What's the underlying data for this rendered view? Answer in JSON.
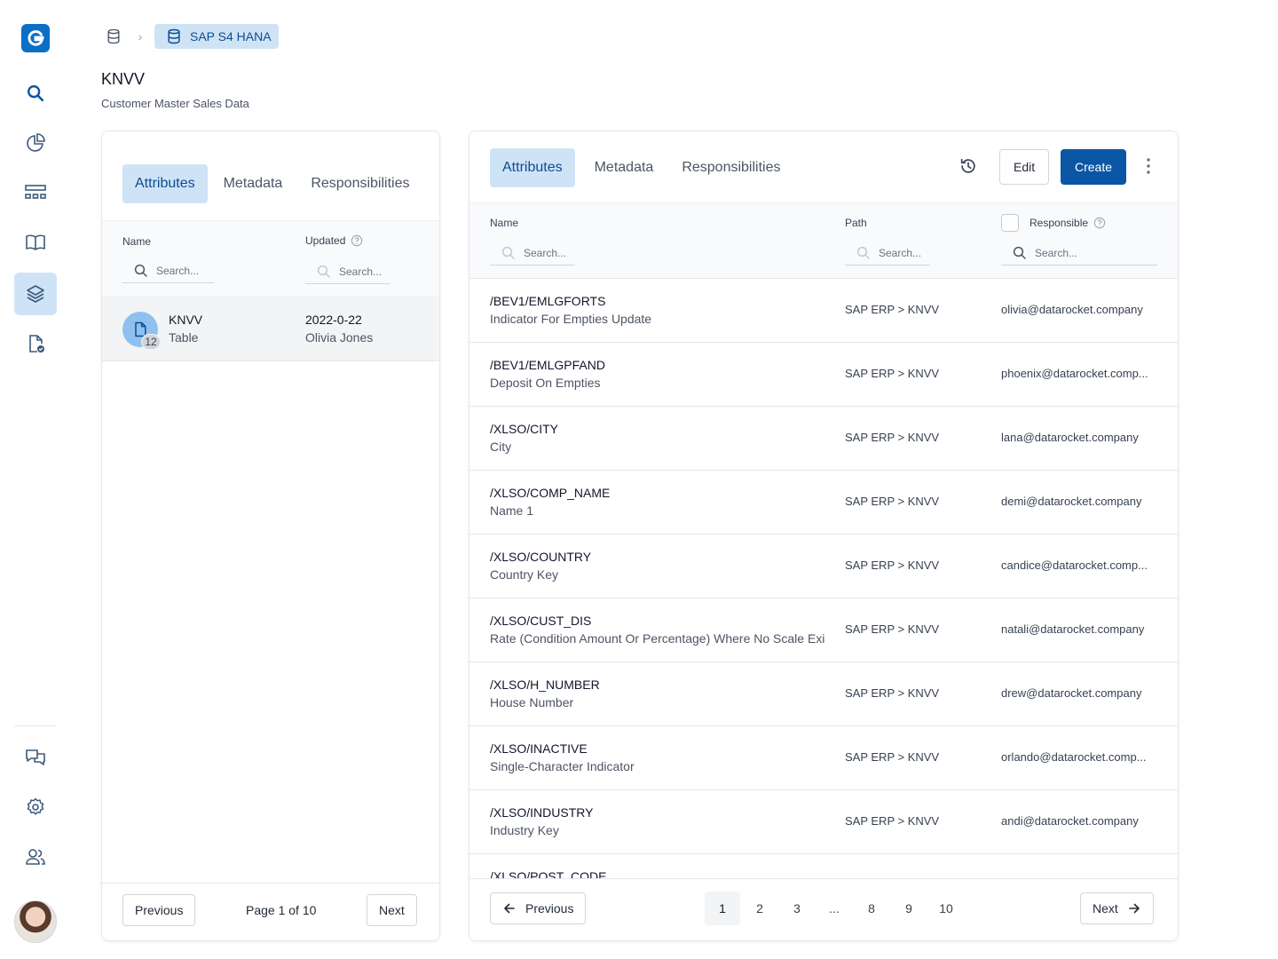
{
  "breadcrumb": {
    "current": "SAP S4 HANA",
    "separator": "›"
  },
  "page": {
    "title": "KNVV",
    "subtitle": "Customer Master Sales Data"
  },
  "left_panel": {
    "tabs": [
      "Attributes",
      "Metadata",
      "Responsibilities"
    ],
    "active_tab": "Attributes",
    "columns": {
      "name": "Name",
      "updated": "Updated"
    },
    "search_placeholder": "Search...",
    "row": {
      "name": "KNVV",
      "type": "Table",
      "badge": "12",
      "date": "2022-0-22",
      "user": "Olivia Jones"
    },
    "footer": {
      "previous": "Previous",
      "page_info": "Page 1 of 10",
      "next": "Next"
    }
  },
  "right_panel": {
    "tabs": [
      "Attributes",
      "Metadata",
      "Responsibilities"
    ],
    "active_tab": "Attributes",
    "edit_label": "Edit",
    "create_label": "Create",
    "columns": {
      "name": "Name",
      "path": "Path",
      "responsible": "Responsible"
    },
    "search_placeholder": "Search...",
    "rows": [
      {
        "name": "/BEV1/EMLGFORTS",
        "desc": "Indicator For Empties Update",
        "path": "SAP ERP > KNVV",
        "email": "olivia@datarocket.company"
      },
      {
        "name": "/BEV1/EMLGPFAND",
        "desc": "Deposit On Empties",
        "path": "SAP ERP > KNVV",
        "email": "phoenix@datarocket.comp..."
      },
      {
        "name": "/XLSO/CITY",
        "desc": "City",
        "path": "SAP ERP > KNVV",
        "email": "lana@datarocket.company"
      },
      {
        "name": "/XLSO/COMP_NAME",
        "desc": "Name 1",
        "path": "SAP ERP > KNVV",
        "email": "demi@datarocket.company"
      },
      {
        "name": "/XLSO/COUNTRY",
        "desc": "Country Key",
        "path": "SAP ERP > KNVV",
        "email": "candice@datarocket.comp..."
      },
      {
        "name": "/XLSO/CUST_DIS",
        "desc": "Rate (Condition Amount Or Percentage) Where No Scale Exist",
        "path": "SAP ERP > KNVV",
        "email": "natali@datarocket.company"
      },
      {
        "name": "/XLSO/H_NUMBER",
        "desc": "House Number",
        "path": "SAP ERP > KNVV",
        "email": "drew@datarocket.company"
      },
      {
        "name": "/XLSO/INACTIVE",
        "desc": "Single-Character Indicator",
        "path": "SAP ERP > KNVV",
        "email": "orlando@datarocket.comp..."
      },
      {
        "name": "/XLSO/INDUSTRY",
        "desc": "Industry Key",
        "path": "SAP ERP > KNVV",
        "email": "andi@datarocket.company"
      },
      {
        "name": "/XLSO/POST_CODE",
        "desc": "",
        "path": "",
        "email": ""
      }
    ],
    "pagination": {
      "previous": "Previous",
      "next": "Next",
      "pages": [
        "1",
        "2",
        "3",
        "...",
        "8",
        "9",
        "10"
      ],
      "current": "1"
    }
  }
}
